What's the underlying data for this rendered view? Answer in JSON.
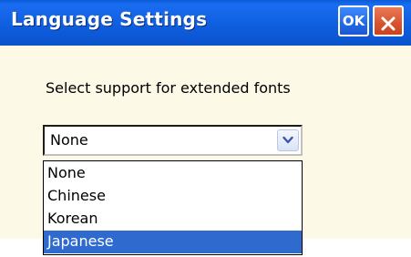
{
  "window": {
    "title": "Language Settings",
    "ok_label": "OK",
    "titlebar_color": "#0f5fe0",
    "body_color": "#fcf9e6"
  },
  "dialog": {
    "prompt": "Select support for extended fonts",
    "combo": {
      "selected_value": "None",
      "expanded": true
    }
  },
  "dropdown": {
    "options": [
      "None",
      "Chinese",
      "Korean",
      "Japanese"
    ],
    "highlighted": "Japanese",
    "highlight_color": "#2f6bce"
  },
  "icons": {
    "close": "close-icon",
    "combo_arrow": "chevron-down-icon"
  }
}
